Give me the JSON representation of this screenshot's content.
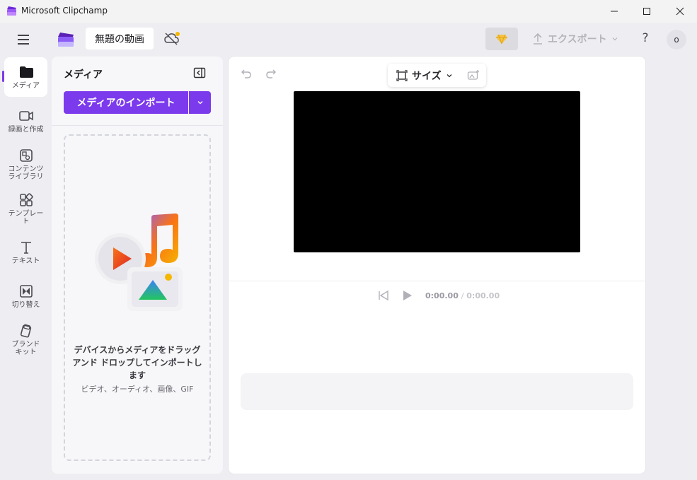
{
  "window": {
    "app_title": "Microsoft Clipchamp"
  },
  "topbar": {
    "project_title": "無題の動画",
    "export_label": "エクスポート",
    "help_label": "?",
    "avatar_initial": "o"
  },
  "rail": {
    "items": [
      {
        "label": "メディア"
      },
      {
        "label": "録画と作成"
      },
      {
        "label": "コンテンツ\nライブラリ"
      },
      {
        "label": "テンプレー\nト"
      },
      {
        "label": "テキスト"
      },
      {
        "label": "切り替え"
      },
      {
        "label": "ブランド\nキット"
      }
    ]
  },
  "media_panel": {
    "title": "メディア",
    "import_label": "メディアのインポート",
    "drop_main": "デバイスからメディアをドラッグ アンド ドロップしてインポートします",
    "drop_sub": "ビデオ、オーディオ、画像、GIF"
  },
  "stage": {
    "size_label": "サイズ",
    "time_current": "0:00.00",
    "time_separator": "/",
    "time_total": "0:00.00"
  },
  "colors": {
    "accent": "#7c3aed",
    "background": "#eeeef2",
    "preview": "#000000"
  }
}
